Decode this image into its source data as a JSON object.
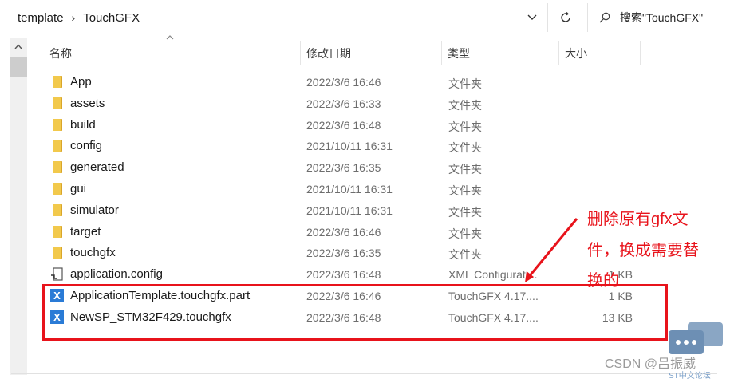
{
  "breadcrumb": {
    "parent": "template",
    "current": "TouchGFX"
  },
  "search": {
    "placeholder": "搜索\"TouchGFX\""
  },
  "columns": {
    "name": "名称",
    "date": "修改日期",
    "type": "类型",
    "size": "大小"
  },
  "files": [
    {
      "name": "App",
      "date": "2022/3/6 16:46",
      "type": "文件夹",
      "size": "",
      "icon": "folder-icon"
    },
    {
      "name": "assets",
      "date": "2022/3/6 16:33",
      "type": "文件夹",
      "size": "",
      "icon": "folder-icon"
    },
    {
      "name": "build",
      "date": "2022/3/6 16:48",
      "type": "文件夹",
      "size": "",
      "icon": "folder-icon"
    },
    {
      "name": "config",
      "date": "2021/10/11 16:31",
      "type": "文件夹",
      "size": "",
      "icon": "folder-icon"
    },
    {
      "name": "generated",
      "date": "2022/3/6 16:35",
      "type": "文件夹",
      "size": "",
      "icon": "folder-icon"
    },
    {
      "name": "gui",
      "date": "2021/10/11 16:31",
      "type": "文件夹",
      "size": "",
      "icon": "folder-icon"
    },
    {
      "name": "simulator",
      "date": "2021/10/11 16:31",
      "type": "文件夹",
      "size": "",
      "icon": "folder-icon"
    },
    {
      "name": "target",
      "date": "2022/3/6 16:46",
      "type": "文件夹",
      "size": "",
      "icon": "folder-icon"
    },
    {
      "name": "touchgfx",
      "date": "2022/3/6 16:35",
      "type": "文件夹",
      "size": "",
      "icon": "folder-icon"
    },
    {
      "name": "application.config",
      "date": "2022/3/6 16:48",
      "type": "XML Configurati...",
      "size": "1 KB",
      "icon": "config-file-icon"
    },
    {
      "name": "ApplicationTemplate.touchgfx.part",
      "date": "2022/3/6 16:46",
      "type": "TouchGFX 4.17....",
      "size": "1 KB",
      "icon": "touchgfx-file-icon"
    },
    {
      "name": "NewSP_STM32F429.touchgfx",
      "date": "2022/3/6 16:48",
      "type": "TouchGFX 4.17....",
      "size": "13 KB",
      "icon": "touchgfx-file-icon"
    }
  ],
  "annotation": {
    "lines": [
      "删除原有gfx文",
      "件，换成需要替",
      "换的"
    ],
    "color": "#e8131b"
  },
  "watermark": {
    "main": "CSDN @吕振威",
    "sub": "ST中文论坛"
  }
}
